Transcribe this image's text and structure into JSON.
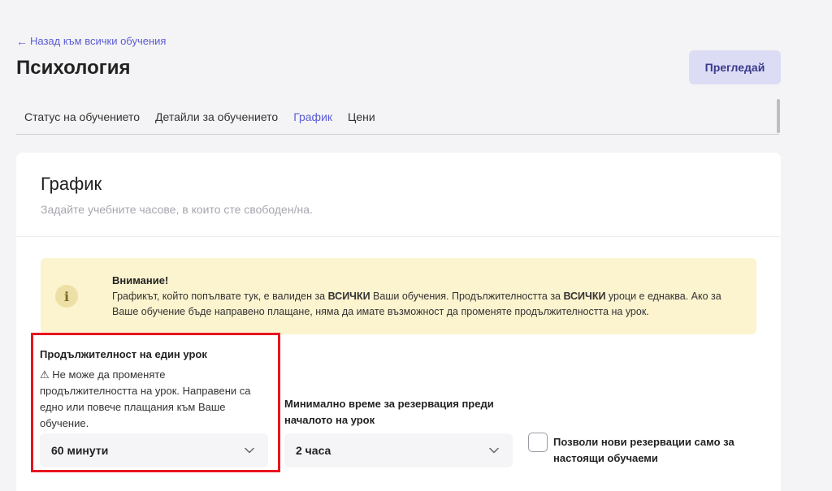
{
  "header": {
    "back_link": "Назад към всички обучения",
    "title": "Психология",
    "preview_button": "Прегледай"
  },
  "tabs": [
    {
      "label": "Статус на обучението"
    },
    {
      "label": "Детайли за обучението"
    },
    {
      "label": "График"
    },
    {
      "label": "Цени"
    }
  ],
  "active_tab": "График",
  "card": {
    "title": "График",
    "subtitle": "Задайте учебните часове, в които сте свободен/на."
  },
  "alert": {
    "title": "Внимание!",
    "text_1": "Графикът, който попълвате тук, е валиден за ",
    "bold_1": "ВСИЧКИ",
    "text_2": " Ваши обучения. Продължителността за ",
    "bold_2": "ВСИЧКИ",
    "text_3": " уроци е еднаква. Ако за Ваше обучение бъде направено плащане, няма да имате възможност да променяте продължителността на урок."
  },
  "lesson_duration": {
    "label": "Продължителност на един урок",
    "warning": "Не може да променяте продължителността на урок. Направени са едно или повече плащания към Ваше обучение.",
    "value": "60 минути"
  },
  "min_booking_time": {
    "label": "Минимално време за резервация преди началото на урок",
    "value": "2 часа"
  },
  "current_students_only": {
    "label": "Позволи нови резервации само за настоящи обучаеми",
    "checked": false
  },
  "colors": {
    "accent": "#5b5bd6",
    "alert_bg": "#fcf3cf",
    "highlight": "#e8141e"
  }
}
